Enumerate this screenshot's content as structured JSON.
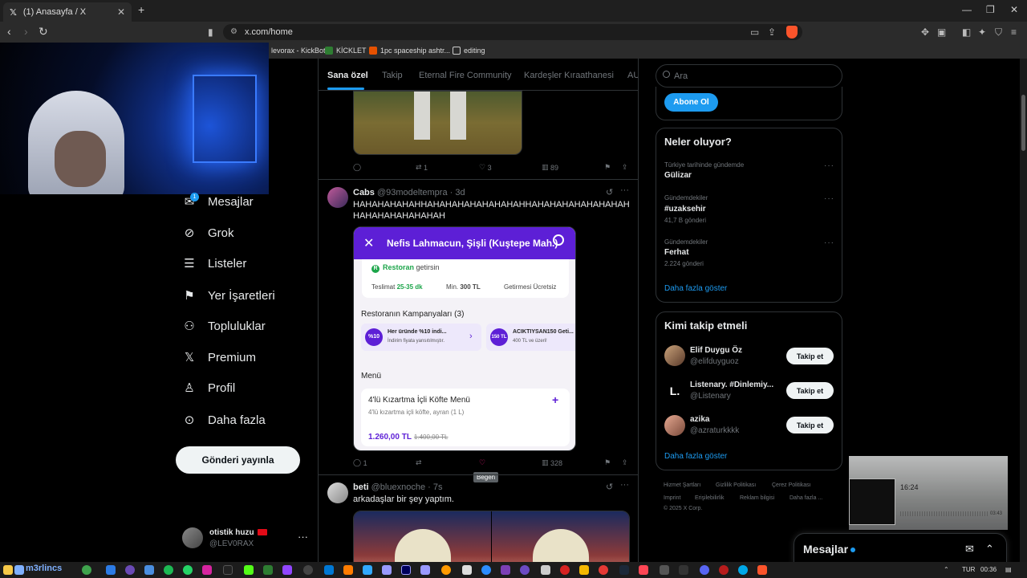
{
  "browser": {
    "tab_title": "(1) Anasayfa / X",
    "url": "x.com/home",
    "bookmarks": [
      "levorax - KickBot",
      "KİCKLET",
      "1pc spaceship ashtr...",
      "editing"
    ]
  },
  "sidebar": {
    "items": [
      {
        "label": "Mesajlar",
        "icon": "mail-icon"
      },
      {
        "label": "Grok",
        "icon": "grok-icon"
      },
      {
        "label": "Listeler",
        "icon": "list-icon"
      },
      {
        "label": "Yer İşaretleri",
        "icon": "bookmark-icon"
      },
      {
        "label": "Topluluklar",
        "icon": "communities-icon"
      },
      {
        "label": "Premium",
        "icon": "x-logo-icon"
      },
      {
        "label": "Profil",
        "icon": "person-icon"
      },
      {
        "label": "Daha fazla",
        "icon": "more-circle-icon"
      }
    ],
    "messages_badge": "1",
    "post_button": "Gönderi yayınla",
    "profile": {
      "name": "otistik huzu",
      "handle": "@LEV0RAX"
    }
  },
  "feed": {
    "tabs": [
      "Sana özel",
      "Takip",
      "Eternal Fire Community",
      "Kardeşler Kıraathanesi",
      "AU"
    ],
    "post0": {
      "retweets": "1",
      "likes": "3",
      "views": "89"
    },
    "post1": {
      "name": "Cabs",
      "handle": "@93modeltempra",
      "time": "3d",
      "text": "HAHAHAHAHAHHAHAHAHAHAHAHAHAHHAHAHAHAHAHAHAHAHHAHAHAHAHAHAHAH",
      "replies": "1",
      "views": "328",
      "like_tooltip": "Beğen",
      "app": {
        "title": "Nefis Lahmacun, Şişli (Kuştepe Mah.)",
        "restaurant_badge": "R",
        "restaurant_prefix": "Restoran",
        "restaurant_suffix": "getirsin",
        "delivery_label": "Teslimat",
        "delivery_value": "25-35 dk",
        "min_label": "Min.",
        "min_value": "300 TL",
        "free_delivery": "Getirmesi Ücretsiz",
        "campaigns_title": "Restoranın Kampanyaları (3)",
        "camp1_badge": "%10",
        "camp1_title": "Her üründe %10 indi...",
        "camp1_desc": "İndirim fiyata yansıtılmıştır.",
        "camp2_badge": "150 TL",
        "camp2_title": "ACIKTIYSAN150 Geti...",
        "camp2_desc": "400 TL ve üzeri!",
        "menu_title": "Menü",
        "item_name": "4'lü Kızartma İçli Köfte Menü",
        "item_desc": "4'lü kızartma içli köfte, ayran (1 L)",
        "price": "1.260,00 TL",
        "old_price": "1.400,00 TL"
      }
    },
    "post2": {
      "name": "beti",
      "handle": "@bluexnoche",
      "time": "7s",
      "text": "arkadaşlar bir şey yaptım."
    }
  },
  "right": {
    "search_placeholder": "Ara",
    "subscribe": "Abone Ol",
    "trends_title": "Neler oluyor?",
    "trends": [
      {
        "context": "Türkiye tarihinde gündemde",
        "name": "Gülizar",
        "count": ""
      },
      {
        "context": "Gündemdekiler",
        "name": "#uzaksehir",
        "count": "41,7 B gönderi"
      },
      {
        "context": "Gündemdekiler",
        "name": "Ferhat",
        "count": "2.224 gönderi"
      }
    ],
    "show_more": "Daha fazla göster",
    "who_title": "Kimi takip etmeli",
    "who": [
      {
        "name": "Elif Duygu Öz",
        "handle": "@elifduyguoz",
        "button": "Takip et"
      },
      {
        "name": "Listenary. #Dinlemiy...",
        "handle": "@Listenary",
        "button": "Takip et"
      },
      {
        "name": "azika",
        "handle": "@azraturkkkk",
        "button": "Takip et"
      }
    ],
    "who_more": "Daha fazla göster",
    "footer": [
      "Hizmet Şartları",
      "Gizlilik Politikası",
      "Çerez Politikası",
      "Imprint",
      "Erişilebilirlik",
      "Reklam bilgisi",
      "Daha fazla ...",
      "© 2025 X Corp."
    ]
  },
  "player": {
    "time": "16:24",
    "duration": "03:43"
  },
  "messages_drawer": "Mesajlar",
  "taskbar": {
    "label": "m3rlincs",
    "lang": "TUR",
    "clock": "00:36"
  }
}
